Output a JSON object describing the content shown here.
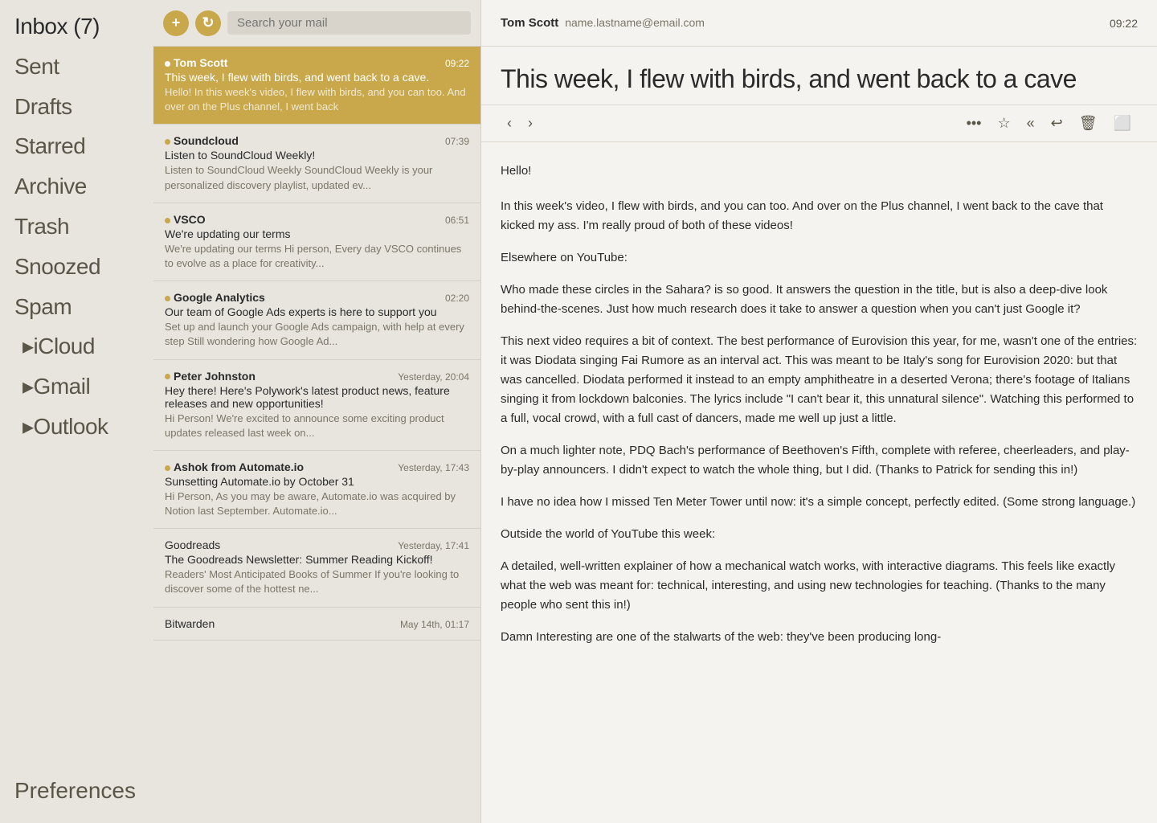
{
  "sidebar": {
    "items": [
      {
        "id": "inbox",
        "label": "Inbox",
        "count": "(7)",
        "active": true,
        "sub": false
      },
      {
        "id": "sent",
        "label": "Sent",
        "count": "",
        "active": false,
        "sub": false
      },
      {
        "id": "drafts",
        "label": "Drafts",
        "count": "",
        "active": false,
        "sub": false
      },
      {
        "id": "starred",
        "label": "Starred",
        "count": "",
        "active": false,
        "sub": false
      },
      {
        "id": "archive",
        "label": "Archive",
        "count": "",
        "active": false,
        "sub": false
      },
      {
        "id": "trash",
        "label": "Trash",
        "count": "",
        "active": false,
        "sub": false
      },
      {
        "id": "snoozed",
        "label": "Snoozed",
        "count": "",
        "active": false,
        "sub": false
      },
      {
        "id": "spam",
        "label": "Spam",
        "count": "",
        "active": false,
        "sub": false
      },
      {
        "id": "icloud",
        "label": "iCloud",
        "count": "",
        "active": false,
        "sub": true
      },
      {
        "id": "gmail",
        "label": "Gmail",
        "count": "",
        "active": false,
        "sub": true
      },
      {
        "id": "outlook",
        "label": "Outlook",
        "count": "",
        "active": false,
        "sub": true
      }
    ],
    "preferences_label": "Preferences"
  },
  "search": {
    "add_label": "+",
    "refresh_label": "↻",
    "placeholder": "Search your mail"
  },
  "emails": [
    {
      "id": "tom-scott",
      "sender": "Tom Scott",
      "time": "09:22",
      "subject": "This week, I flew with birds, and went back to a cave.",
      "preview": "Hello! In this week's video, I flew with birds, and you can too. And over on the Plus channel, I went back",
      "unread": true,
      "selected": true
    },
    {
      "id": "soundcloud",
      "sender": "Soundcloud",
      "time": "07:39",
      "subject": "Listen to SoundCloud Weekly!",
      "preview": "Listen to SoundCloud Weekly SoundCloud Weekly is your personalized discovery playlist, updated ev...",
      "unread": true,
      "selected": false
    },
    {
      "id": "vsco",
      "sender": "VSCO",
      "time": "06:51",
      "subject": "We're updating our terms",
      "preview": "We're updating our terms Hi person, Every day VSCO continues to evolve as a place for creativity...",
      "unread": true,
      "selected": false
    },
    {
      "id": "google-analytics",
      "sender": "Google Analytics",
      "time": "02:20",
      "subject": "Our team of Google Ads experts is here to support you",
      "preview": "Set up and launch your Google Ads campaign, with help at every step Still wondering how Google Ad...",
      "unread": true,
      "selected": false
    },
    {
      "id": "peter-johnston",
      "sender": "Peter Johnston",
      "time": "Yesterday, 20:04",
      "subject": "Hey there! Here's Polywork's latest product news, feature releases and new opportunities!",
      "preview": "Hi Person! We're excited to announce some exciting product updates released last week on...",
      "unread": true,
      "selected": false
    },
    {
      "id": "ashok-automate",
      "sender": "Ashok from Automate.io",
      "time": "Yesterday, 17:43",
      "subject": "Sunsetting Automate.io by October 31",
      "preview": "Hi Person, As you may be aware, Automate.io was acquired by Notion last September. Automate.io...",
      "unread": true,
      "selected": false
    },
    {
      "id": "goodreads",
      "sender": "Goodreads",
      "time": "Yesterday, 17:41",
      "subject": "The Goodreads Newsletter: Summer Reading Kickoff!",
      "preview": "Readers' Most Anticipated Books of Summer If you're looking to discover some of the hottest ne...",
      "unread": false,
      "selected": false
    },
    {
      "id": "bitwarden",
      "sender": "Bitwarden",
      "time": "May 14th, 01:17",
      "subject": "",
      "preview": "",
      "unread": false,
      "selected": false
    }
  ],
  "detail": {
    "sender_name": "Tom Scott",
    "sender_email": "name.lastname@email.com",
    "time": "09:22",
    "subject": "This week, I flew with birds, and went back to a cave",
    "greeting": "Hello!",
    "body_paragraphs": [
      "In this week's video, I flew with birds, and you can too. And over on the Plus channel, I went back to the cave that kicked my ass. I'm really proud of both of these videos!",
      "Elsewhere on YouTube:",
      "    Who made these circles in the Sahara? is so good. It answers the question in the title, but is also a deep-dive look behind-the-scenes. Just how much research does it take to answer a question when you can't just Google it?",
      "    This next video requires a bit of context. The best performance of Eurovision this year, for me, wasn't one of the entries: it was Diodata singing Fai Rumore as an interval act. This was meant to be Italy's song for Eurovision 2020: but that was cancelled. Diodata performed it instead to an empty amphitheatre in a deserted Verona; there's footage of Italians singing it from lockdown balconies. The lyrics include \"I can't bear it, this unnatural silence\". Watching this performed to a full, vocal crowd, with a full cast of dancers, made me well up just a little.",
      "    On a much lighter note, PDQ Bach's performance of Beethoven's Fifth, complete with referee, cheerleaders, and play-by-play announcers. I didn't expect to watch the whole thing, but I did. (Thanks to Patrick for sending this in!)",
      "    I have no idea how I missed Ten Meter Tower until now: it's a simple concept, perfectly edited. (Some strong language.)",
      "Outside the world of YouTube this week:",
      "    A detailed, well-written explainer of how a mechanical watch works, with interactive diagrams. This feels like exactly what the web was meant for: technical, interesting, and using new technologies for teaching. (Thanks to the many people who sent this in!)",
      "    Damn Interesting are one of the stalwarts of the web: they've been producing long-"
    ],
    "actions": {
      "prev": "‹",
      "next": "›",
      "more": "•••",
      "star": "☆",
      "reply_all": "«",
      "reply": "↩",
      "trash": "🗑",
      "archive": "⬜"
    }
  }
}
